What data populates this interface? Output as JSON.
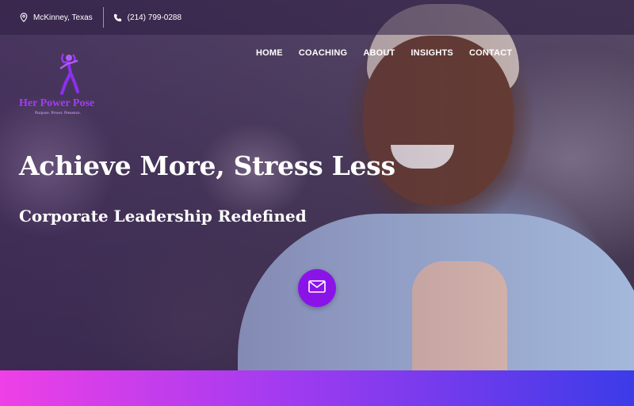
{
  "topbar": {
    "location_icon": "map-pin-icon",
    "location": "McKinney, Texas",
    "phone_icon": "phone-icon",
    "phone": "(214) 799-0288"
  },
  "nav": {
    "items": [
      {
        "label": "HOME"
      },
      {
        "label": "COACHING"
      },
      {
        "label": "ABOUT"
      },
      {
        "label": "INSIGHTS"
      },
      {
        "label": "CONTACT"
      }
    ]
  },
  "logo": {
    "name": "Her Power Pose",
    "tagline": "Purpose. Power. Presence."
  },
  "hero": {
    "headline": "Achieve More, Stress Less",
    "subheadline": "Corporate Leadership Redefined",
    "cta_icon": "envelope-icon"
  },
  "colors": {
    "accent": "#8a14e8",
    "logo": "#a33df0",
    "band_start": "#ee40e6",
    "band_end": "#3c3be8"
  }
}
